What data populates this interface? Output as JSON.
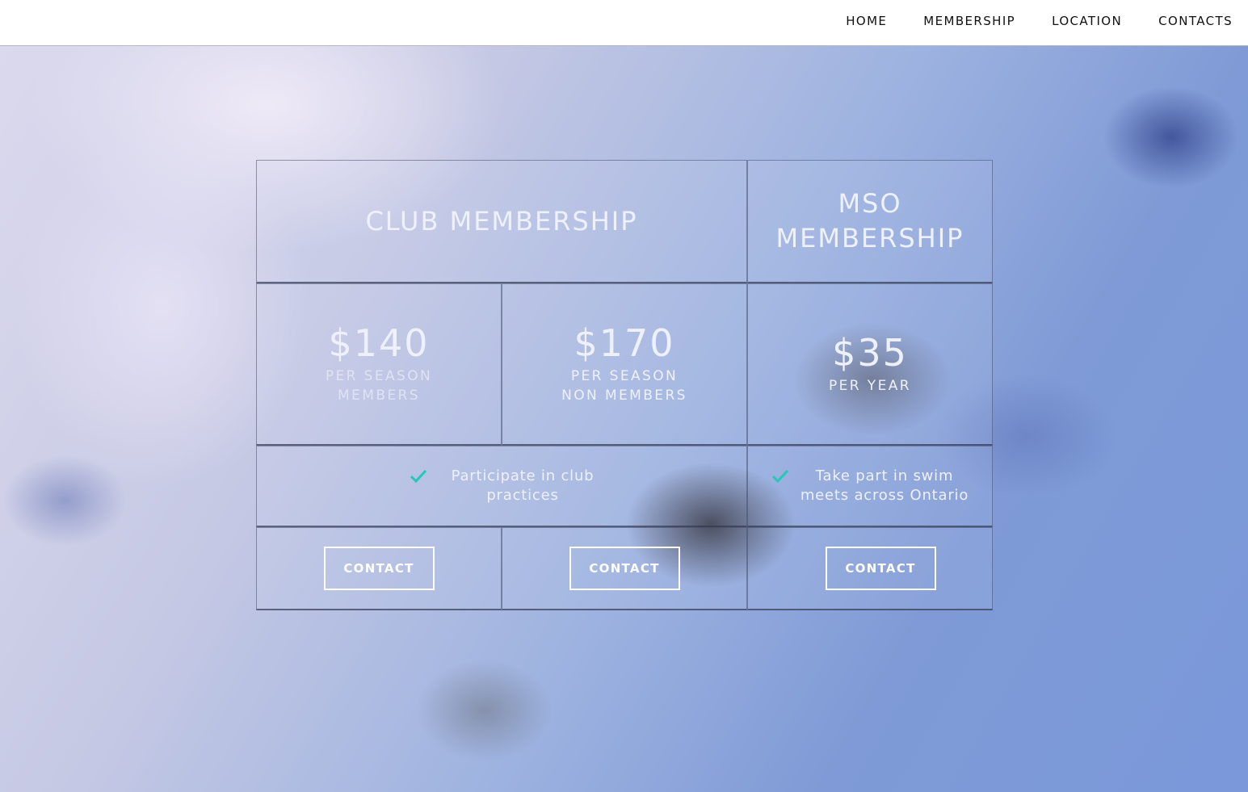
{
  "nav": {
    "items": [
      "HOME",
      "MEMBERSHIP",
      "LOCATION",
      "CONTACTS"
    ]
  },
  "pricing": {
    "club_title": "CLUB MEMBERSHIP",
    "mso_title_line1": "MSO",
    "mso_title_line2": "MEMBERSHIP",
    "plans": [
      {
        "price": "$140",
        "sub_line1": "PER SEASON",
        "sub_line2": "MEMBERS"
      },
      {
        "price": "$170",
        "sub_line1": "PER SEASON",
        "sub_line2": "NON MEMBERS"
      },
      {
        "price": "$35",
        "sub_line1": "PER YEAR",
        "sub_line2": ""
      }
    ],
    "features": [
      {
        "line1": "Participate in club",
        "line2": "practices"
      },
      {
        "line1": "Take part in swim",
        "line2": "meets across Ontario"
      }
    ],
    "button_label": "CONTACT"
  },
  "colors": {
    "check": "#22c9b6",
    "text": "#eef1fa"
  },
  "icons": {
    "feature": "check-icon"
  }
}
